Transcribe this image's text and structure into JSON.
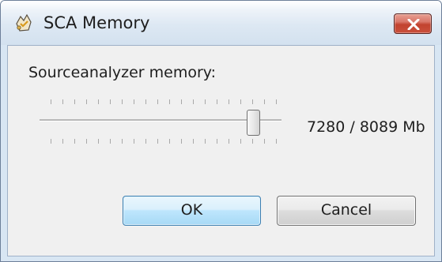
{
  "window": {
    "title": "SCA Memory",
    "icon": "sca-app-icon",
    "close_icon": "close-icon"
  },
  "memory": {
    "label": "Sourceanalyzer memory:",
    "value_text": "7280 / 8089 Mb",
    "current_mb": 7280,
    "max_mb": 8089
  },
  "buttons": {
    "ok_label": "OK",
    "cancel_label": "Cancel"
  },
  "colors": {
    "close_button": "#c9503c",
    "ok_border": "#3c7fb1"
  }
}
